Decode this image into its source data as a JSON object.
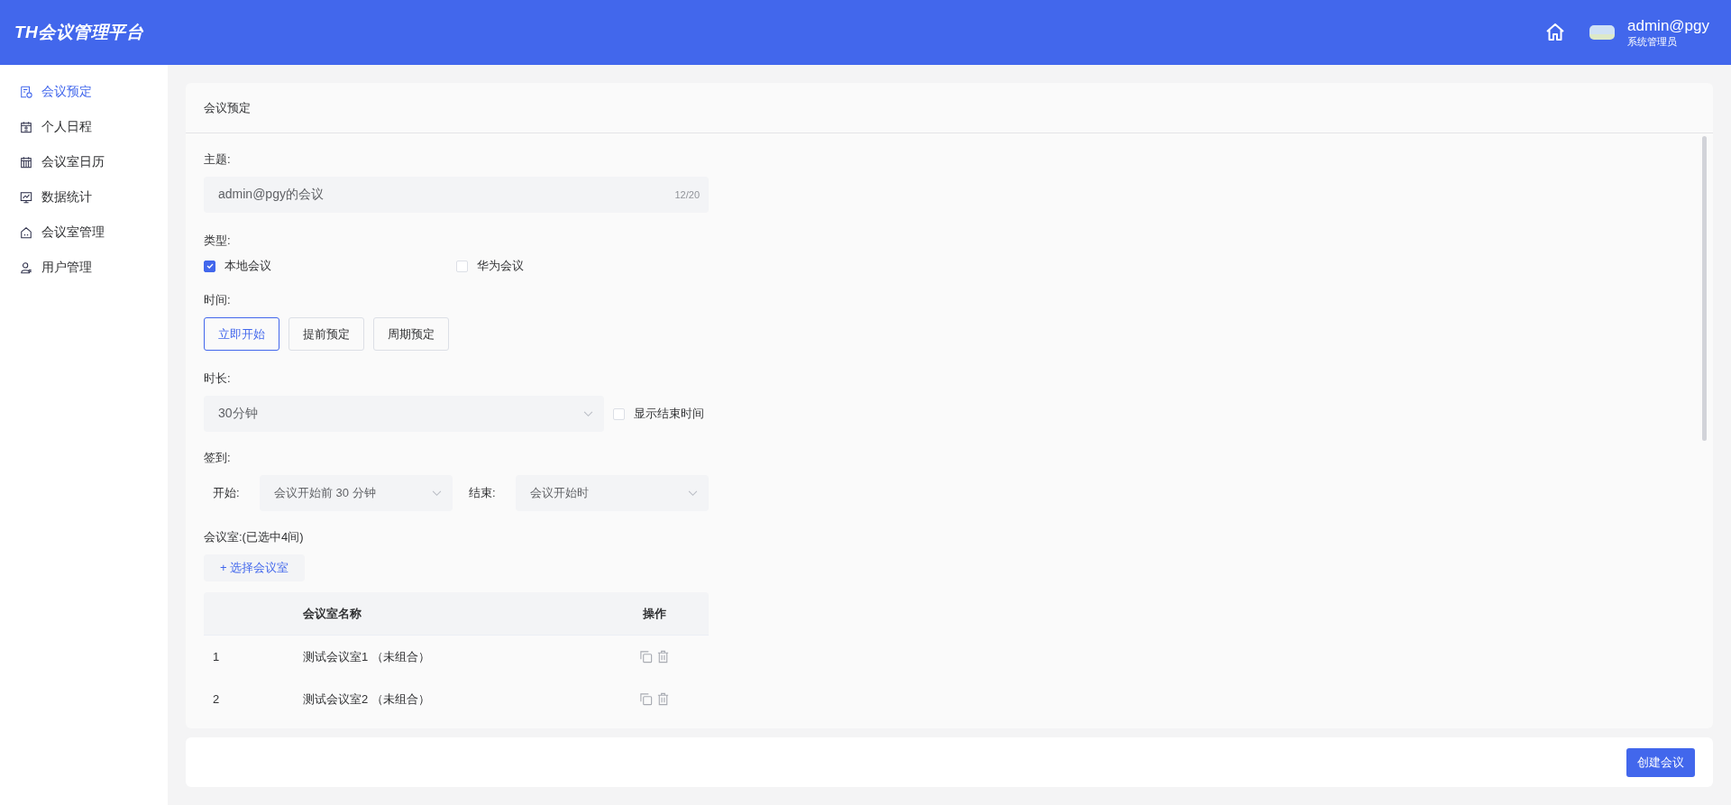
{
  "header": {
    "logo": "TH会议管理平台",
    "user": {
      "name": "admin@pgy",
      "role": "系统管理员"
    }
  },
  "sidebar": {
    "items": [
      {
        "label": "会议预定",
        "selected": true
      },
      {
        "label": "个人日程",
        "selected": false
      },
      {
        "label": "会议室日历",
        "selected": false
      },
      {
        "label": "数据统计",
        "selected": false
      },
      {
        "label": "会议室管理",
        "selected": false
      },
      {
        "label": "用户管理",
        "selected": false
      }
    ]
  },
  "card": {
    "title": "会议预定"
  },
  "form": {
    "subject": {
      "label": "主题:",
      "value": "admin@pgy的会议",
      "count": "12/20"
    },
    "type": {
      "label": "类型:",
      "options": [
        {
          "label": "本地会议",
          "checked": true
        },
        {
          "label": "华为会议",
          "checked": false
        }
      ]
    },
    "time": {
      "label": "时间:",
      "buttons": [
        {
          "label": "立即开始",
          "selected": true
        },
        {
          "label": "提前预定",
          "selected": false
        },
        {
          "label": "周期预定",
          "selected": false
        }
      ]
    },
    "duration": {
      "label": "时长:",
      "value": "30分钟",
      "show_end": {
        "label": "显示结束时间",
        "checked": false
      }
    },
    "checkin": {
      "label": "签到:",
      "start_label": "开始:",
      "start_value": "会议开始前 30 分钟",
      "end_label": "结束:",
      "end_value": "会议开始时"
    },
    "rooms": {
      "label": "会议室:(已选中4间)",
      "add_button": "+ 选择会议室",
      "table": {
        "columns": [
          "",
          "会议室名称",
          "操作"
        ],
        "rows": [
          {
            "index": "1",
            "name": "测试会议室1 （未组合）"
          },
          {
            "index": "2",
            "name": "测试会议室2 （未组合）"
          }
        ]
      }
    }
  },
  "footer": {
    "submit": "创建会议"
  }
}
